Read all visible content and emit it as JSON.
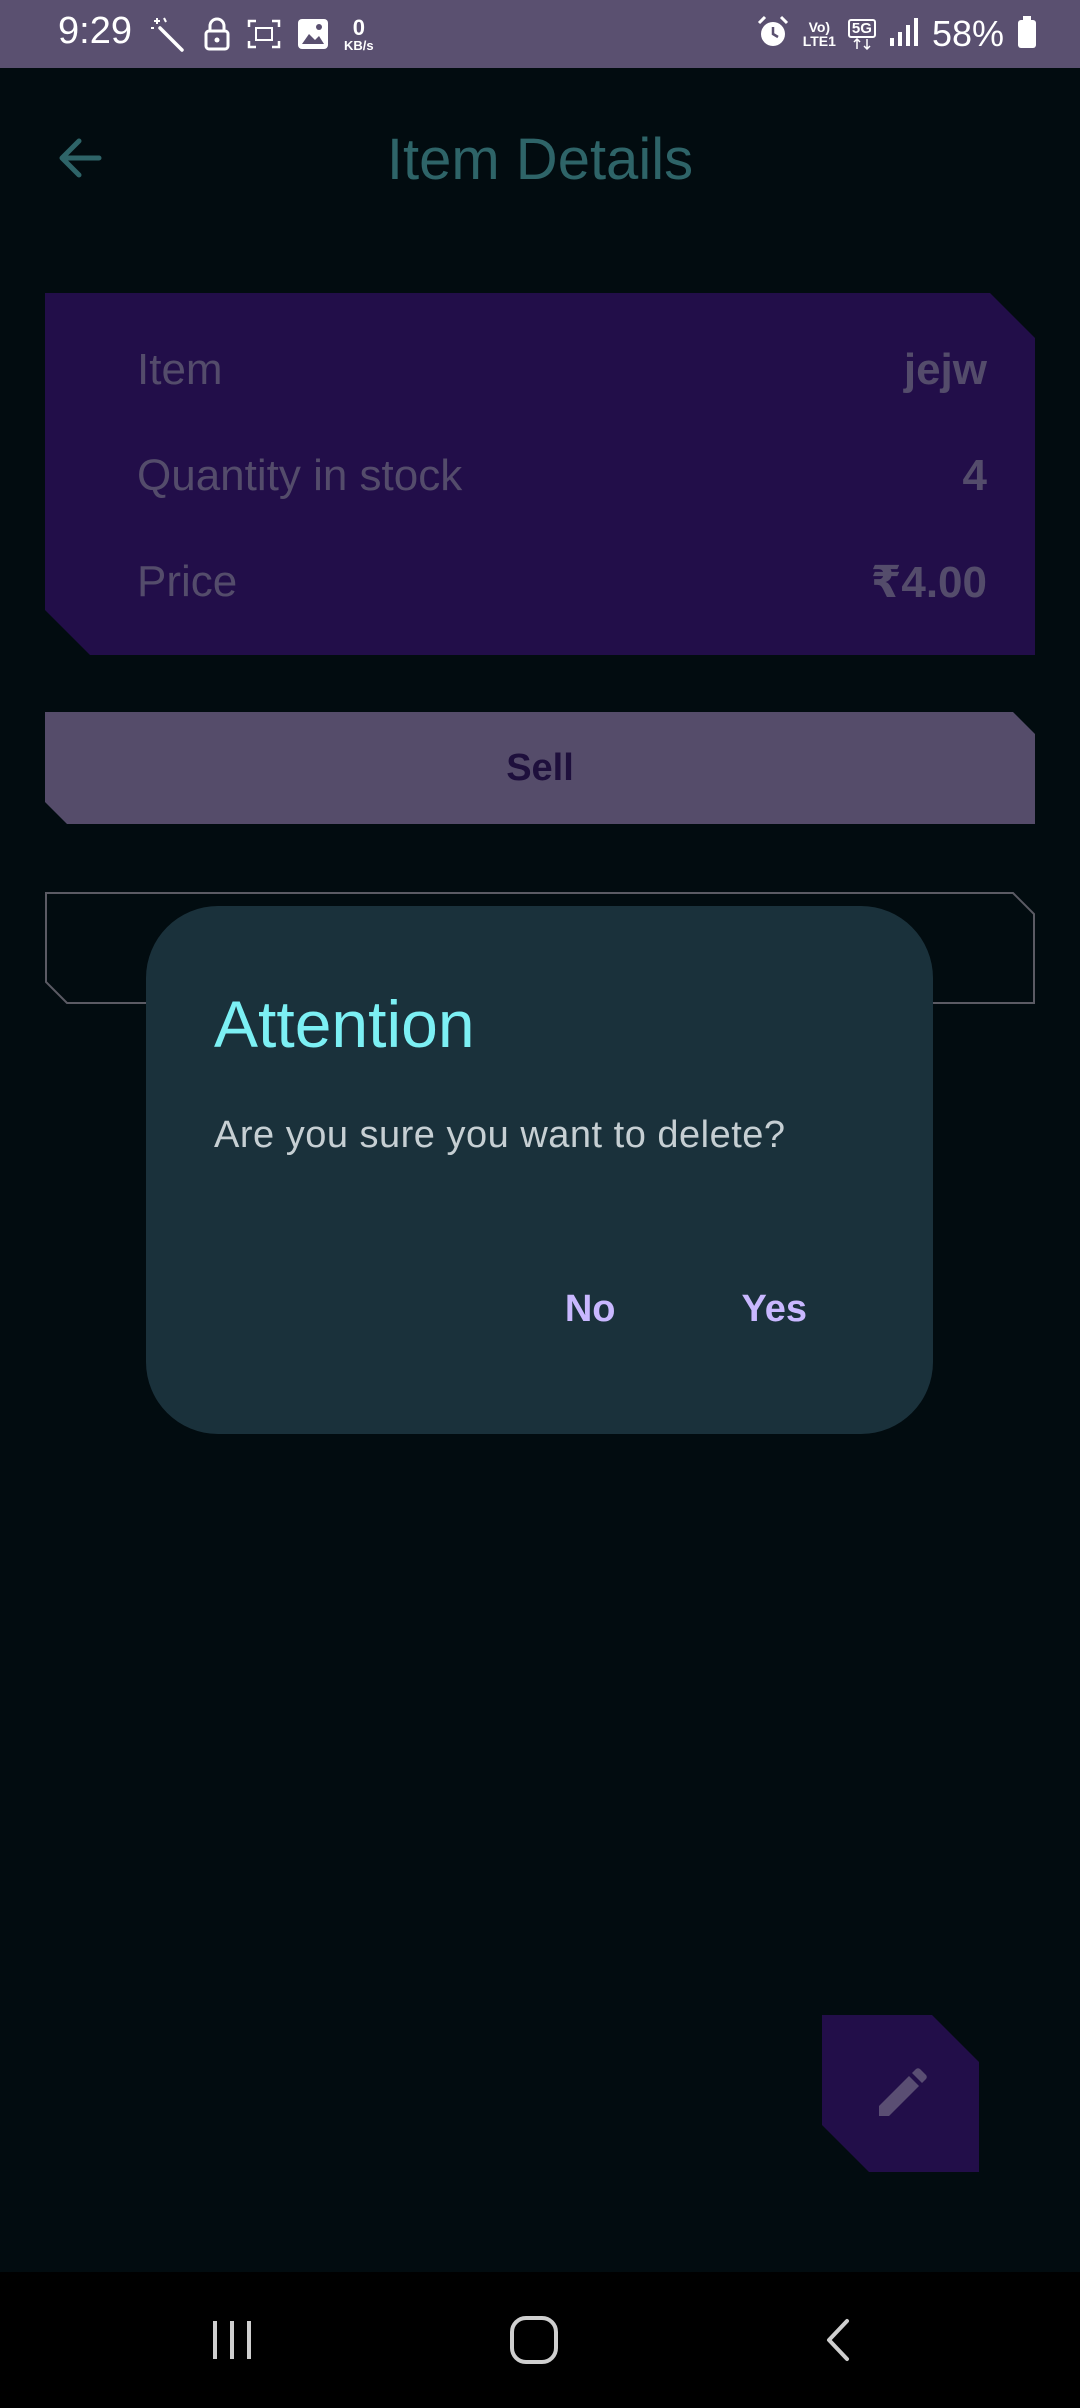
{
  "status_bar": {
    "time": "9:29",
    "data_speed_value": "0",
    "data_speed_unit": "KB/s",
    "volte_top": "Vo)",
    "volte_bottom": "LTE1",
    "network_type": "5G",
    "battery_percent": "58%",
    "icons": [
      "magic-wand-icon",
      "lock-icon",
      "screenshot-icon",
      "image-icon",
      "alarm-icon",
      "signal-icon",
      "battery-icon"
    ]
  },
  "app_bar": {
    "title": "Item Details",
    "back_icon": "arrow-back-icon"
  },
  "details": {
    "rows": [
      {
        "label": "Item",
        "value": "jejw"
      },
      {
        "label": "Quantity in stock",
        "value": "4"
      },
      {
        "label": "Price",
        "value": "₹4.00"
      }
    ]
  },
  "actions": {
    "sell_label": "Sell"
  },
  "dialog": {
    "title": "Attention",
    "message": "Are you sure you want to delete?",
    "no_label": "No",
    "yes_label": "Yes"
  },
  "fab": {
    "icon": "edit-pencil-icon"
  },
  "nav_bar": {
    "icons": [
      "recents-icon",
      "home-icon",
      "back-icon"
    ]
  },
  "colors": {
    "background": "#020c10",
    "status_bar": "#5a5070",
    "card": "#220e49",
    "sell_button": "#554c6a",
    "dialog": "#1a313b",
    "dialog_title": "#7cf0f4",
    "dialog_action": "#c9b8ff",
    "title": "#2e6468"
  }
}
